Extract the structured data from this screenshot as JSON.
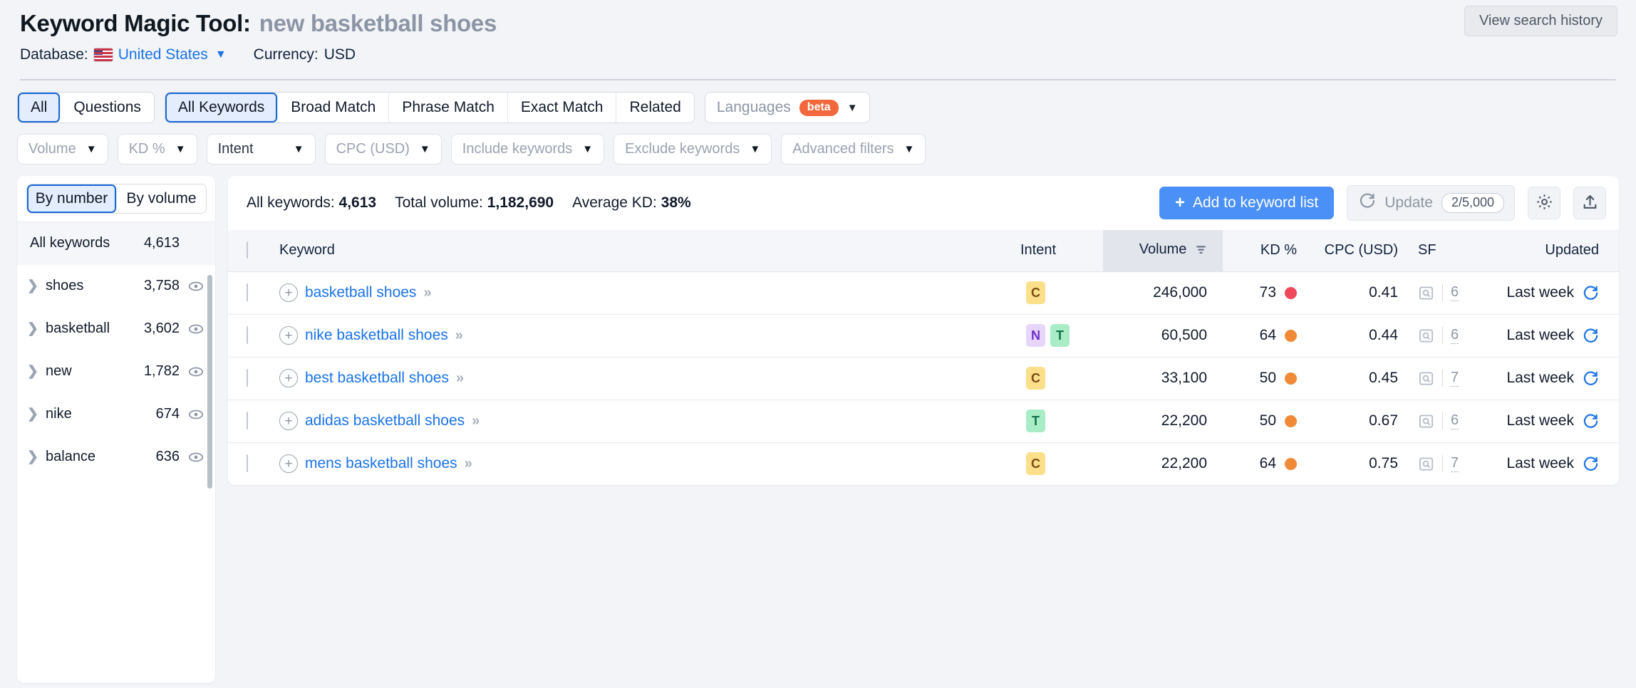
{
  "header": {
    "title_main": "Keyword Magic Tool:",
    "title_query": "new basketball shoes",
    "database_label": "Database:",
    "database_value": "United States",
    "currency_label": "Currency:",
    "currency_value": "USD",
    "history_button": "View search history"
  },
  "filters": {
    "question_tabs": [
      {
        "label": "All",
        "active": true
      },
      {
        "label": "Questions",
        "active": false
      }
    ],
    "match_tabs": [
      {
        "label": "All Keywords",
        "active": true
      },
      {
        "label": "Broad Match",
        "active": false
      },
      {
        "label": "Phrase Match",
        "active": false
      },
      {
        "label": "Exact Match",
        "active": false
      },
      {
        "label": "Related",
        "active": false
      }
    ],
    "languages": {
      "label": "Languages",
      "badge": "beta"
    },
    "pills": [
      {
        "label": "Volume",
        "muted": true
      },
      {
        "label": "KD %",
        "muted": true
      },
      {
        "label": "Intent",
        "muted": false
      },
      {
        "label": "CPC (USD)",
        "muted": true
      },
      {
        "label": "Include keywords",
        "muted": true
      },
      {
        "label": "Exclude keywords",
        "muted": true
      },
      {
        "label": "Advanced filters",
        "muted": true
      }
    ]
  },
  "sidebar": {
    "toggle": [
      {
        "label": "By number",
        "active": true
      },
      {
        "label": "By volume",
        "active": false
      }
    ],
    "all_keywords": {
      "label": "All keywords",
      "count": "4,613"
    },
    "groups": [
      {
        "label": "shoes",
        "count": "3,758"
      },
      {
        "label": "basketball",
        "count": "3,602"
      },
      {
        "label": "new",
        "count": "1,782"
      },
      {
        "label": "nike",
        "count": "674"
      },
      {
        "label": "balance",
        "count": "636"
      }
    ]
  },
  "toolbar": {
    "all_keywords_label": "All keywords:",
    "all_keywords_value": "4,613",
    "total_volume_label": "Total volume:",
    "total_volume_value": "1,182,690",
    "average_kd_label": "Average KD:",
    "average_kd_value": "38%",
    "add_button": "Add to keyword list",
    "add_button_plus": "+",
    "update_button": "Update",
    "update_count": "2/5,000"
  },
  "table": {
    "columns": {
      "keyword": "Keyword",
      "intent": "Intent",
      "volume": "Volume",
      "kd": "KD %",
      "cpc": "CPC (USD)",
      "sf": "SF",
      "updated": "Updated"
    },
    "rows": [
      {
        "keyword": "basketball shoes",
        "intents": [
          "C"
        ],
        "volume": "246,000",
        "kd": "73",
        "kd_color": "#f0485b",
        "cpc": "0.41",
        "sf": "6",
        "updated": "Last week"
      },
      {
        "keyword": "nike basketball shoes",
        "intents": [
          "N",
          "T"
        ],
        "volume": "60,500",
        "kd": "64",
        "kd_color": "#f08a36",
        "cpc": "0.44",
        "sf": "6",
        "updated": "Last week"
      },
      {
        "keyword": "best basketball shoes",
        "intents": [
          "C"
        ],
        "volume": "33,100",
        "kd": "50",
        "kd_color": "#f08a36",
        "cpc": "0.45",
        "sf": "7",
        "updated": "Last week"
      },
      {
        "keyword": "adidas basketball shoes",
        "intents": [
          "T"
        ],
        "volume": "22,200",
        "kd": "50",
        "kd_color": "#f08a36",
        "cpc": "0.67",
        "sf": "6",
        "updated": "Last week"
      },
      {
        "keyword": "mens basketball shoes",
        "intents": [
          "C"
        ],
        "volume": "22,200",
        "kd": "64",
        "kd_color": "#f08a36",
        "cpc": "0.75",
        "sf": "7",
        "updated": "Last week"
      }
    ]
  },
  "colors": {
    "accent_blue": "#1a73e8",
    "primary_button": "#4a90f7",
    "beta_orange": "#f2683c",
    "kd_red": "#f0485b",
    "kd_orange": "#f08a36"
  }
}
